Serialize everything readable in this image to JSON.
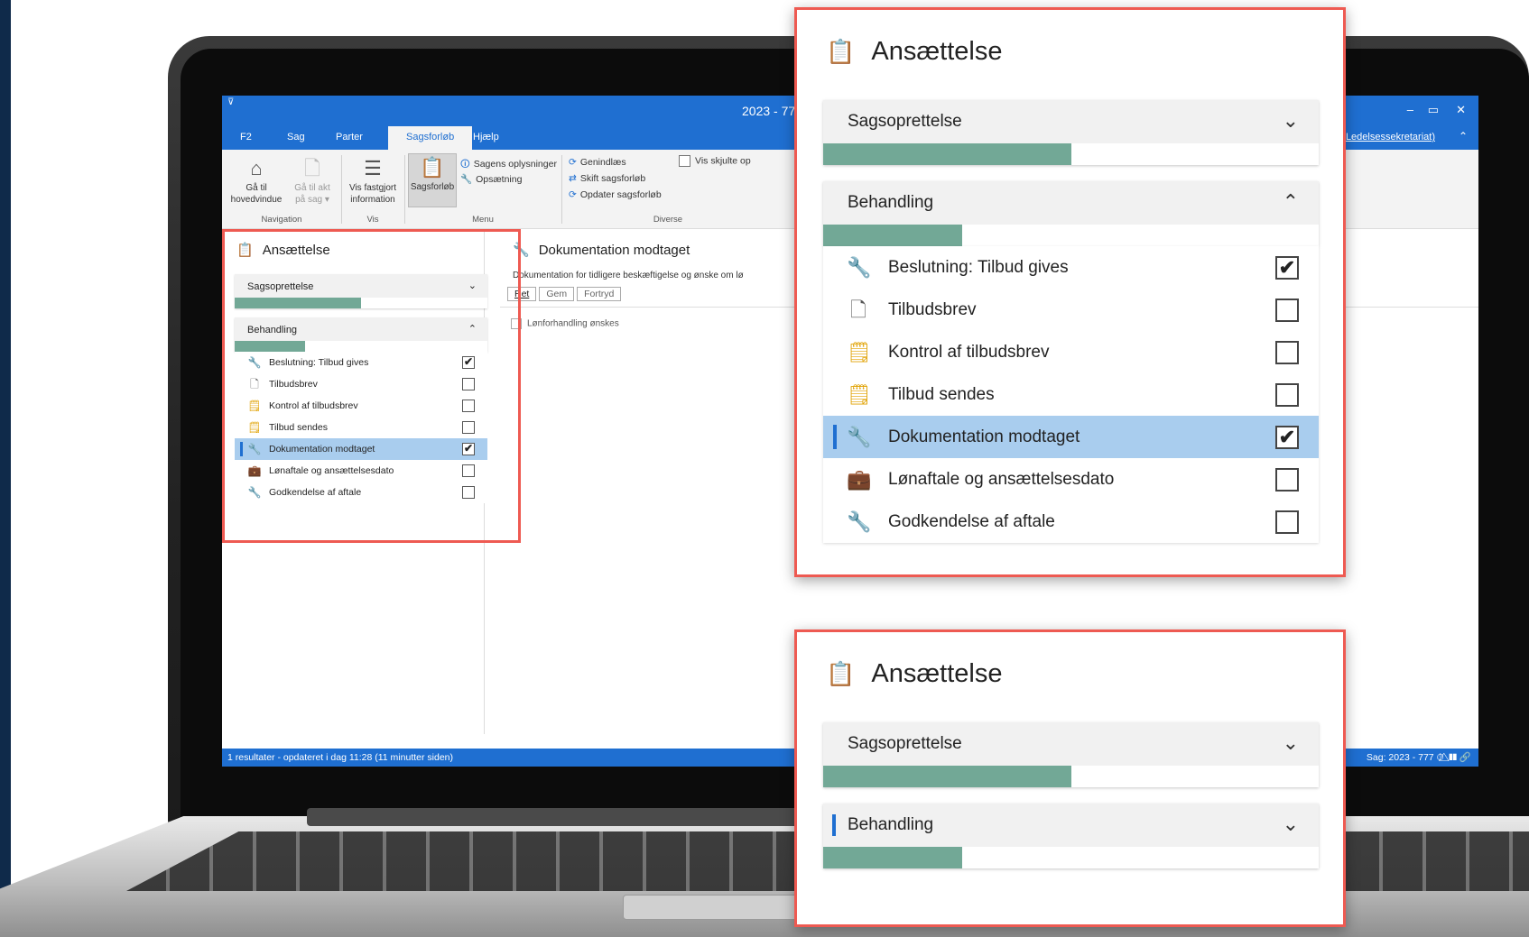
{
  "window": {
    "title": "2023 - 777",
    "quick_access": "⊽",
    "controls": [
      "–",
      "▭",
      "✕"
    ]
  },
  "menu": {
    "tabs": [
      "F2",
      "Sag",
      "Parter",
      "Sagsforløb",
      "Hjælp"
    ],
    "active_tab": "Sagsforløb",
    "department_link": "Ledelsessekretariat)",
    "collapse_glyph": "⌃"
  },
  "ribbon": {
    "goto_main": "Gå til\nhovedvindue",
    "goto_act": "Gå til akt\npå sag ▾",
    "show_fixed": "Vis fastgjort\ninformation",
    "sagsforloeb": "Sagsforløb",
    "case_info": "Sagens oplysninger",
    "setup": "Opsætning",
    "reload": "Genindlæs",
    "switch_flow": "Skift sagsforløb",
    "update_flow": "Opdater sagsforløb",
    "show_hidden": "Vis skjulte op",
    "groups": {
      "navigation": "Navigation",
      "vis": "Vis",
      "menu": "Menu",
      "diverse": "Diverse"
    }
  },
  "panel": {
    "title": "Ansættelse",
    "sections": [
      {
        "label": "Sagsoprettelse",
        "progress": 0.5,
        "expanded": false
      },
      {
        "label": "Behandling",
        "progress": 0.28,
        "expanded": true
      }
    ],
    "steps": [
      {
        "label": "Beslutning: Tilbud gives",
        "icon": "wrench-icon",
        "glyph": "🔧",
        "checked": true,
        "selected": false
      },
      {
        "label": "Tilbudsbrev",
        "icon": "document-icon",
        "glyph": "🗋",
        "checked": false,
        "selected": false
      },
      {
        "label": "Kontrol af tilbudsbrev",
        "icon": "note-icon",
        "glyph": "🗒",
        "checked": false,
        "selected": false
      },
      {
        "label": "Tilbud sendes",
        "icon": "note-icon",
        "glyph": "🗒",
        "checked": false,
        "selected": false
      },
      {
        "label": "Dokumentation modtaget",
        "icon": "wrench-icon",
        "glyph": "🔧",
        "checked": true,
        "selected": true
      },
      {
        "label": "Lønaftale og ansættelsesdato",
        "icon": "briefcase-info-icon",
        "glyph": "💼",
        "checked": false,
        "selected": false
      },
      {
        "label": "Godkendelse af aftale",
        "icon": "wrench-icon",
        "glyph": "🔧",
        "checked": false,
        "selected": false
      }
    ],
    "check_glyph": "✔"
  },
  "detail": {
    "title": "Dokumentation modtaget",
    "description": "Dokumentation for tidligere beskæftigelse og ønske om lø",
    "buttons": {
      "edit": "Ret",
      "save": "Gem",
      "undo": "Fortryd"
    },
    "checkbox_label": "Lønforhandling ønskes"
  },
  "status": {
    "left": "1 resultater - opdateret i dag 11:28 (11 minutter siden)",
    "right": "Sag: 2023 - 777 ⏱ ⃤ ❚❚ 🔗"
  },
  "colors": {
    "accent": "#1f6fd1",
    "progress": "#72a896",
    "highlight": "#ee5a52",
    "selected_row": "#a9cdee"
  }
}
